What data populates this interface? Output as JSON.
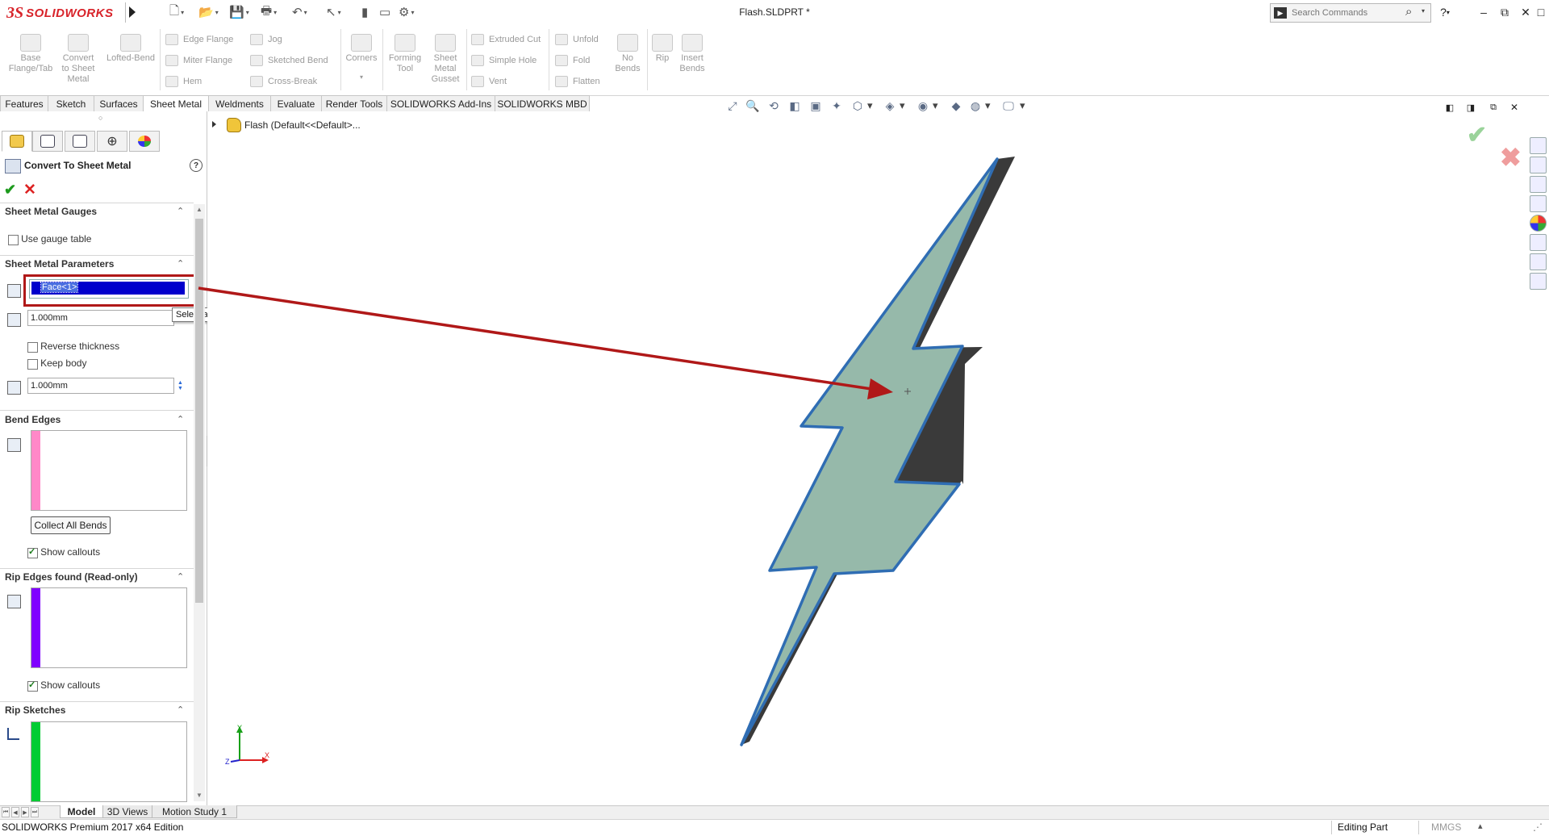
{
  "app": {
    "brand_prefix": "3S",
    "brand_name": "SOLIDWORKS",
    "document_title": "Flash.SLDPRT *"
  },
  "search": {
    "placeholder": "Search Commands"
  },
  "toolbar": {
    "big_tools": [
      {
        "label": "Base\nFlange/Tab"
      },
      {
        "label": "Convert\nto Sheet\nMetal"
      },
      {
        "label": "Lofted-Bend"
      },
      {
        "label": "Corners"
      },
      {
        "label": "Forming\nTool"
      },
      {
        "label": "Sheet\nMetal\nGusset"
      },
      {
        "label": "No\nBends"
      },
      {
        "label": "Rip"
      },
      {
        "label": "Insert\nBends"
      }
    ],
    "small_tools": [
      {
        "label": "Edge Flange"
      },
      {
        "label": "Miter Flange"
      },
      {
        "label": "Hem"
      },
      {
        "label": "Jog"
      },
      {
        "label": "Sketched Bend"
      },
      {
        "label": "Cross-Break"
      },
      {
        "label": "Extruded Cut"
      },
      {
        "label": "Simple Hole"
      },
      {
        "label": "Vent"
      },
      {
        "label": "Unfold"
      },
      {
        "label": "Fold"
      },
      {
        "label": "Flatten"
      }
    ]
  },
  "tabs": [
    {
      "label": "Features"
    },
    {
      "label": "Sketch"
    },
    {
      "label": "Surfaces"
    },
    {
      "label": "Sheet Metal",
      "active": true
    },
    {
      "label": "Weldments"
    },
    {
      "label": "Evaluate"
    },
    {
      "label": "Render Tools"
    },
    {
      "label": "SOLIDWORKS Add-Ins"
    },
    {
      "label": "SOLIDWORKS MBD"
    }
  ],
  "property_manager": {
    "title": "Convert To Sheet Metal",
    "help": "?",
    "sections": {
      "gauges": {
        "title": "Sheet Metal Gauges",
        "use_gauge_table": "Use gauge table"
      },
      "parameters": {
        "title": "Sheet Metal Parameters",
        "fixed_face": "Face<1>",
        "thickness": "1.000mm",
        "reverse_thickness": "Reverse thickness",
        "keep_body": "Keep body",
        "bend_radius": "1.000mm",
        "tooltip": "Select a fixed entity"
      },
      "bend_edges": {
        "title": "Bend Edges",
        "collect_all_bends": "Collect All Bends",
        "show_callouts": "Show callouts",
        "color": "#ff88c8"
      },
      "rip_edges": {
        "title": "Rip Edges found (Read-only)",
        "show_callouts": "Show callouts",
        "color": "#8000ff"
      },
      "rip_sketches": {
        "title": "Rip Sketches",
        "color": "#00cc33"
      }
    }
  },
  "feature_tree": {
    "label": "Flash  (Default<<Default>..."
  },
  "model": {
    "face_color": "#96b9aa",
    "edge_color": "#2f6db3",
    "side_color": "#3a3a3a"
  },
  "annotation": {
    "callout_color": "#b01818"
  },
  "bottom_tabs": [
    {
      "label": "Model",
      "active": true
    },
    {
      "label": "3D Views"
    },
    {
      "label": "Motion Study 1"
    }
  ],
  "status": {
    "edition": "SOLIDWORKS Premium 2017 x64 Edition",
    "mode": "Editing Part",
    "units": "MMGS"
  }
}
